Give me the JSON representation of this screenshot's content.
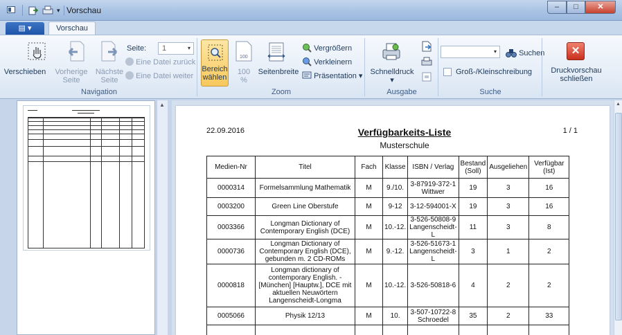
{
  "window": {
    "title": "Vorschau"
  },
  "tabs": {
    "file_label": "▤ ▾",
    "active": "Vorschau"
  },
  "ribbon": {
    "navigation": {
      "label": "Navigation",
      "move": "Verschieben",
      "prev_line1": "Vorherige",
      "prev_line2": "Seite",
      "next_line1": "Nächste",
      "next_line2": "Seite",
      "page_label": "Seite:",
      "page_value": "1",
      "prev_file": "Eine Datei zurück",
      "next_file": "Eine Datei weiter"
    },
    "zoom": {
      "label": "Zoom",
      "select_line1": "Bereich",
      "select_line2": "wählen",
      "percent_line1": "100",
      "percent_line2": "%",
      "pagewidth": "Seitenbreite",
      "zoom_in": "Vergrößern",
      "zoom_out": "Verkleinern",
      "presentation": "Präsentation"
    },
    "output": {
      "label": "Ausgabe",
      "quickprint": "Schnelldruck"
    },
    "search": {
      "label": "Suche",
      "search_btn": "Suchen",
      "case": "Groß-/Kleinschreibung",
      "input_value": ""
    },
    "close": {
      "line1": "Druckvorschau",
      "line2": "schließen"
    }
  },
  "document": {
    "date": "22.09.2016",
    "title": "Verfügbarkeits-Liste",
    "subtitle": "Musterschule",
    "page": "1 / 1",
    "headers": [
      "Medien-Nr",
      "Titel",
      "Fach",
      "Klasse",
      "ISBN / Verlag",
      "Bestand (Soll)",
      "Ausgeliehen",
      "Verfügbar (Ist)"
    ],
    "rows": [
      [
        "0000314",
        "Formelsammlung Mathematik",
        "M",
        "9./10.",
        "3-87919-372-1 Wittwer",
        "19",
        "3",
        "16"
      ],
      [
        "0003200",
        "Green Line Oberstufe",
        "M",
        "9-12",
        "3-12-594001-X",
        "19",
        "3",
        "16"
      ],
      [
        "0003366",
        "Longman Dictionary of Contemporary English (DCE)",
        "M",
        "10.-12.",
        "3-526-50808-9 Langenscheidt-L",
        "11",
        "3",
        "8"
      ],
      [
        "0000736",
        "Longman Dictionary of Contemporary English (DCE), gebunden m. 2 CD-ROMs",
        "M",
        "9.-12.",
        "3-526-51673-1 Langenscheidt-L",
        "3",
        "1",
        "2"
      ],
      [
        "0000818",
        "Longman dictionary of contemporary English. - [München] [Hauptw.], DCE mit aktuellen Neuwörtern Langenscheidt-Longma",
        "M",
        "10.-12.",
        "3-526-50818-6",
        "4",
        "2",
        "2"
      ],
      [
        "0005066",
        "Physik 12/13",
        "M",
        "10.",
        "3-507-10722-8 Schroedel",
        "35",
        "2",
        "33"
      ]
    ]
  }
}
